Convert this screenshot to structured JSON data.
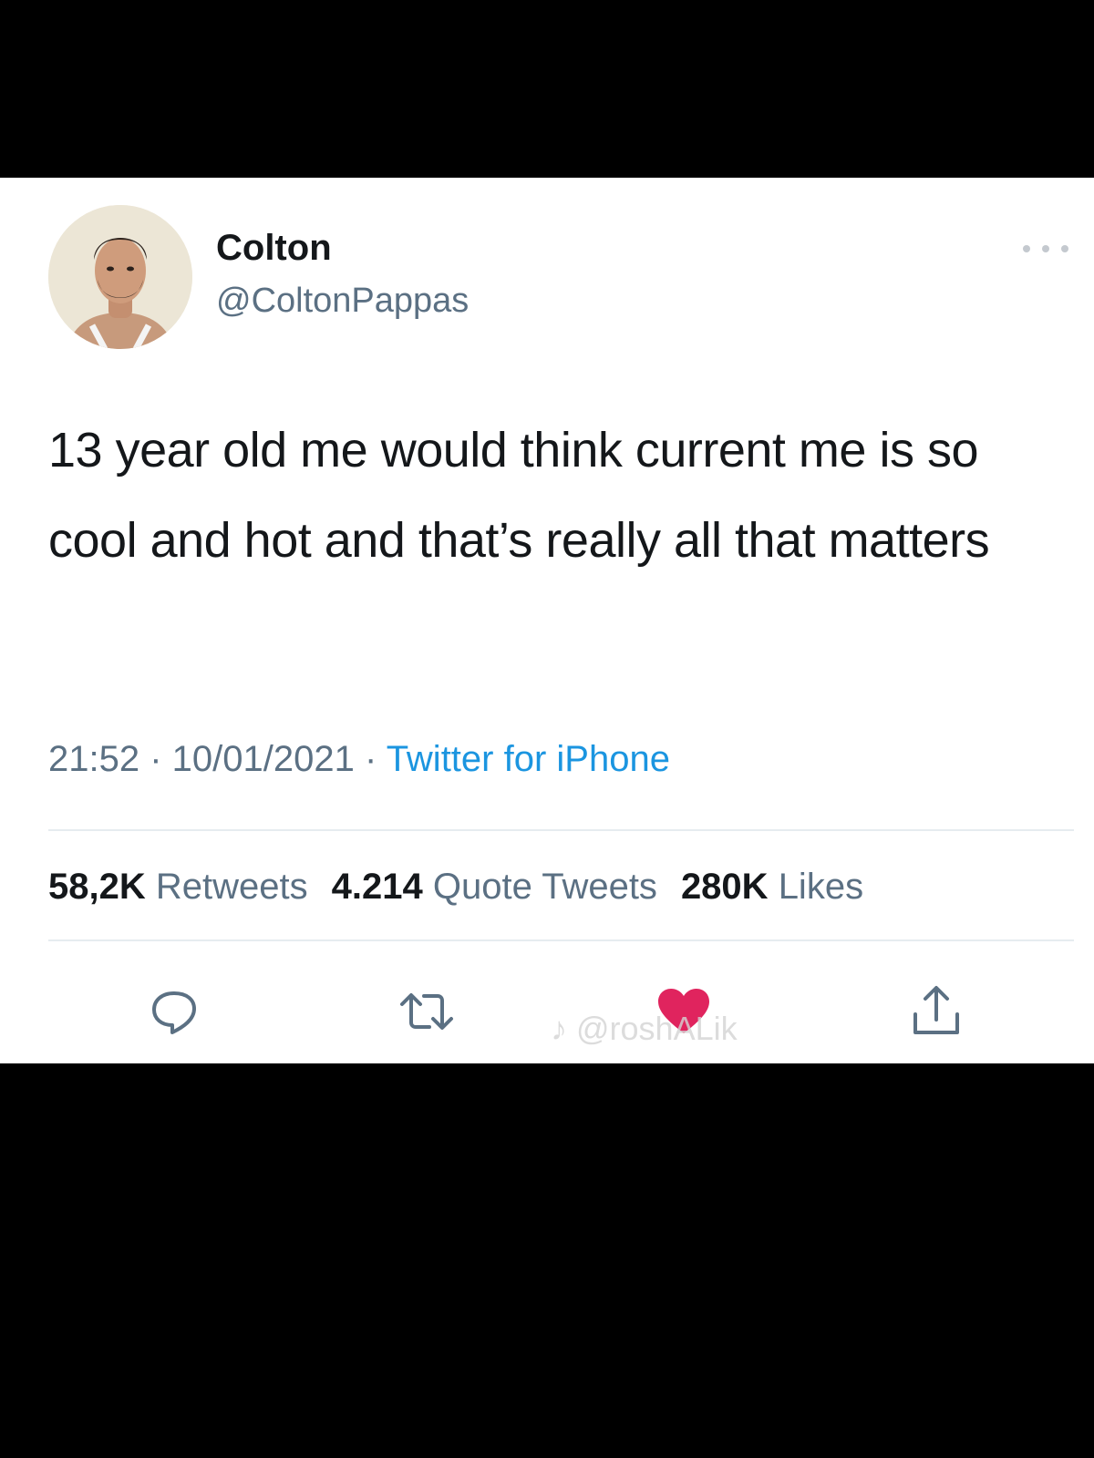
{
  "tweet": {
    "author": {
      "display_name": "Colton",
      "handle": "@ColtonPappas"
    },
    "more_icon": "ellipsis-icon",
    "text": "13 year old me would think current me is so cool and hot and that’s really all that matters",
    "meta": {
      "time": "21:52",
      "separator1": " · ",
      "date": "10/01/2021",
      "separator2": " · ",
      "source": "Twitter for iPhone"
    },
    "stats": {
      "retweets_count": "58,2K",
      "retweets_label": "Retweets",
      "quotes_count": "4.214",
      "quotes_label": "Quote Tweets",
      "likes_count": "280K",
      "likes_label": "Likes"
    },
    "actions": {
      "reply_icon": "reply-icon",
      "retweet_icon": "retweet-icon",
      "like_icon": "heart-icon",
      "share_icon": "share-icon"
    },
    "watermark": "♪ @roshALik"
  },
  "colors": {
    "background_outer": "#000000",
    "card": "#ffffff",
    "text_primary": "#14171a",
    "text_secondary": "#5b7083",
    "link": "#1b95e0",
    "like_active": "#e0245e",
    "icon": "#5b7083"
  }
}
